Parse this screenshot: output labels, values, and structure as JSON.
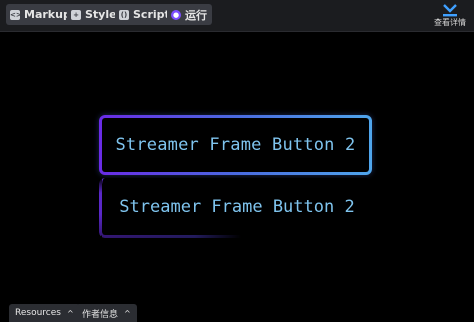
{
  "toolbar": {
    "tabs": [
      {
        "label": "Markup",
        "icon": "code-icon"
      },
      {
        "label": "Style",
        "icon": "plus-square-icon"
      },
      {
        "label": "Script",
        "icon": "script-icon"
      },
      {
        "label": "运行",
        "icon": "run-icon"
      }
    ],
    "detail_label": "查看详情"
  },
  "preview": {
    "button_label": "Streamer Frame Button 2",
    "reflection_label": "Streamer Frame Button 2"
  },
  "footer": {
    "resources_label": "Resources",
    "author_label": "作者信息"
  },
  "colors": {
    "accent_purple": "#6a2be6",
    "accent_blue": "#4fa6ec",
    "text": "#7fc4ee"
  }
}
